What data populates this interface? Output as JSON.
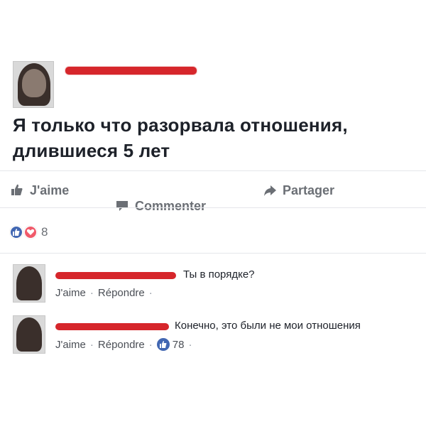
{
  "post": {
    "text": "Я только что разорвала отношения, длившиеся 5 лет"
  },
  "actions": {
    "like_label": "J'aime",
    "comment_label": "Commenter",
    "share_label": "Partager"
  },
  "reactions": {
    "count": "8"
  },
  "comments": [
    {
      "text": "Ты в порядке?",
      "like_label": "J'aime",
      "reply_label": "Répondre",
      "sep": "·"
    },
    {
      "text": "Конечно, это были не мои отношения",
      "like_label": "J'aime",
      "reply_label": "Répondre",
      "sep": "·",
      "likes": "78"
    }
  ],
  "colors": {
    "redaction": "#d6262b",
    "like_blue": "#4267b2",
    "love_red": "#f05a6a",
    "gray_text": "#6b6f75"
  }
}
